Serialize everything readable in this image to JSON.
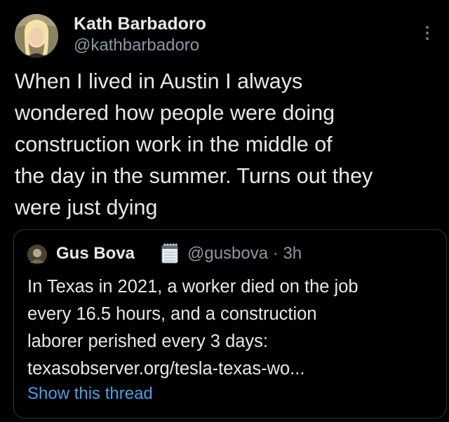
{
  "tweet": {
    "author": {
      "display_name": "Kath Barbadoro",
      "handle": "@kathbarbadoro"
    },
    "text": "When I lived in Austin I always\nwondered how people were doing\nconstruction work in the middle of\nthe day in the summer. Turns out they\nwere just dying",
    "more_icon": "more-vertical-icon"
  },
  "quote": {
    "author": {
      "display_name": "Gus Bova",
      "badge_icon": "spiral-notepad-emoji-icon",
      "handle": "@gusbova",
      "separator": "·",
      "time": "3h"
    },
    "text": "In Texas in 2021, a worker died on the job\nevery 16.5 hours, and a construction\nlaborer perished every 3 days:\ntexasobserver.org/tesla-texas-wo...",
    "show_thread": "Show this thread"
  },
  "colors": {
    "background": "#000000",
    "text_primary": "#e7e9ea",
    "text_secondary": "#8b98a5",
    "link": "#4b9fe6",
    "border": "#2f3336"
  }
}
